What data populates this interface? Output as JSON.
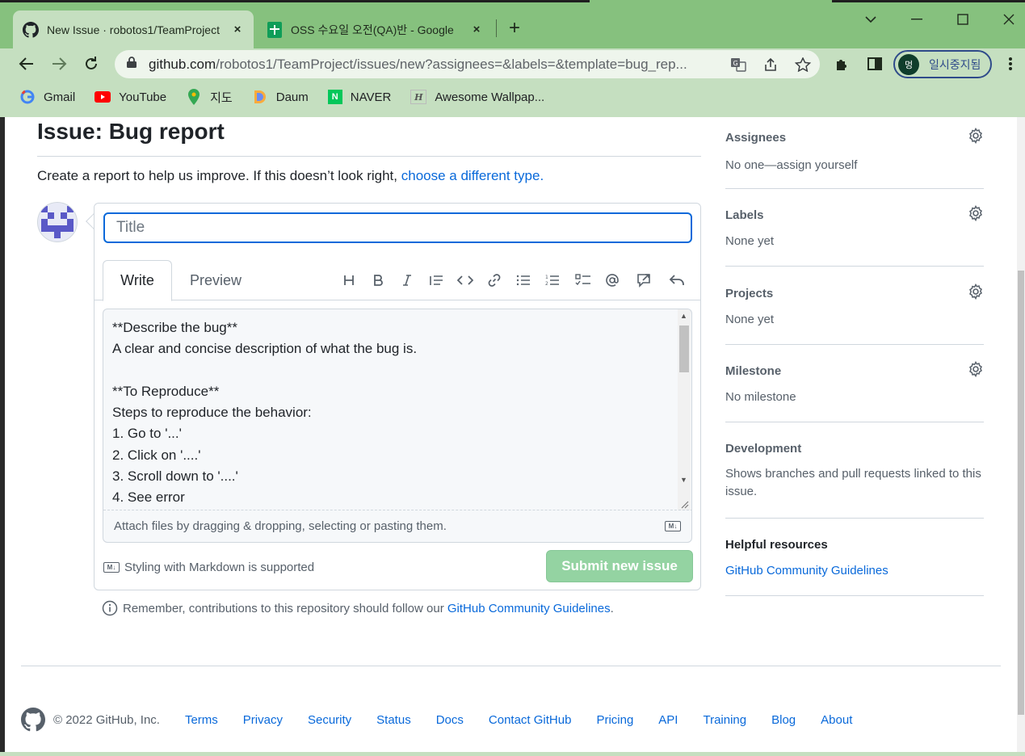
{
  "browser": {
    "tabs": [
      {
        "title": "New Issue · robotos1/TeamProject",
        "close": "×"
      },
      {
        "title": "OSS 수요일 오전(QA)반 - Google",
        "close": "×"
      }
    ],
    "new_tab": "+",
    "window": {
      "minimize": "—",
      "maximize": "☐",
      "close": "✕"
    },
    "url_host": "github.com",
    "url_path": "/robotos1/TeamProject/issues/new?assignees=&labels=&template=bug_rep...",
    "profile": {
      "initial": "멍",
      "label": "일시중지됨"
    },
    "bookmarks": [
      "Gmail",
      "YouTube",
      "지도",
      "Daum",
      "NAVER",
      "Awesome Wallpap..."
    ]
  },
  "issue": {
    "heading": "Issue: Bug report",
    "intro": "Create a report to help us improve. If this doesn’t look right,",
    "intro_link": "choose a different type.",
    "title_placeholder": "Title",
    "tabs": {
      "write": "Write",
      "preview": "Preview"
    },
    "body": "**Describe the bug**\nA clear and concise description of what the bug is.\n\n**To Reproduce**\nSteps to reproduce the behavior:\n1. Go to '...'\n2. Click on '....'\n3. Scroll down to '....'\n4. See error",
    "attach_hint": "Attach files by dragging & dropping, selecting or pasting them.",
    "markdown_note": "Styling with Markdown is supported",
    "submit": "Submit new issue",
    "remember_text": "Remember, contributions to this repository should follow our",
    "remember_link": "GitHub Community Guidelines",
    "remember_end": "."
  },
  "sidebar": {
    "assignees": {
      "heading": "Assignees",
      "value": "No one—assign yourself"
    },
    "labels": {
      "heading": "Labels",
      "value": "None yet"
    },
    "projects": {
      "heading": "Projects",
      "value": "None yet"
    },
    "milestone": {
      "heading": "Milestone",
      "value": "No milestone"
    },
    "development": {
      "heading": "Development",
      "value": "Shows branches and pull requests linked to this issue."
    },
    "resources": {
      "heading": "Helpful resources",
      "link": "GitHub Community Guidelines"
    }
  },
  "footer": {
    "copyright": "© 2022 GitHub, Inc.",
    "links": [
      "Terms",
      "Privacy",
      "Security",
      "Status",
      "Docs",
      "Contact GitHub",
      "Pricing",
      "API",
      "Training",
      "Blog",
      "About"
    ]
  },
  "colors": {
    "accent": "#0969da",
    "submit": "#94d3a2",
    "chrome": "#86c17e"
  }
}
